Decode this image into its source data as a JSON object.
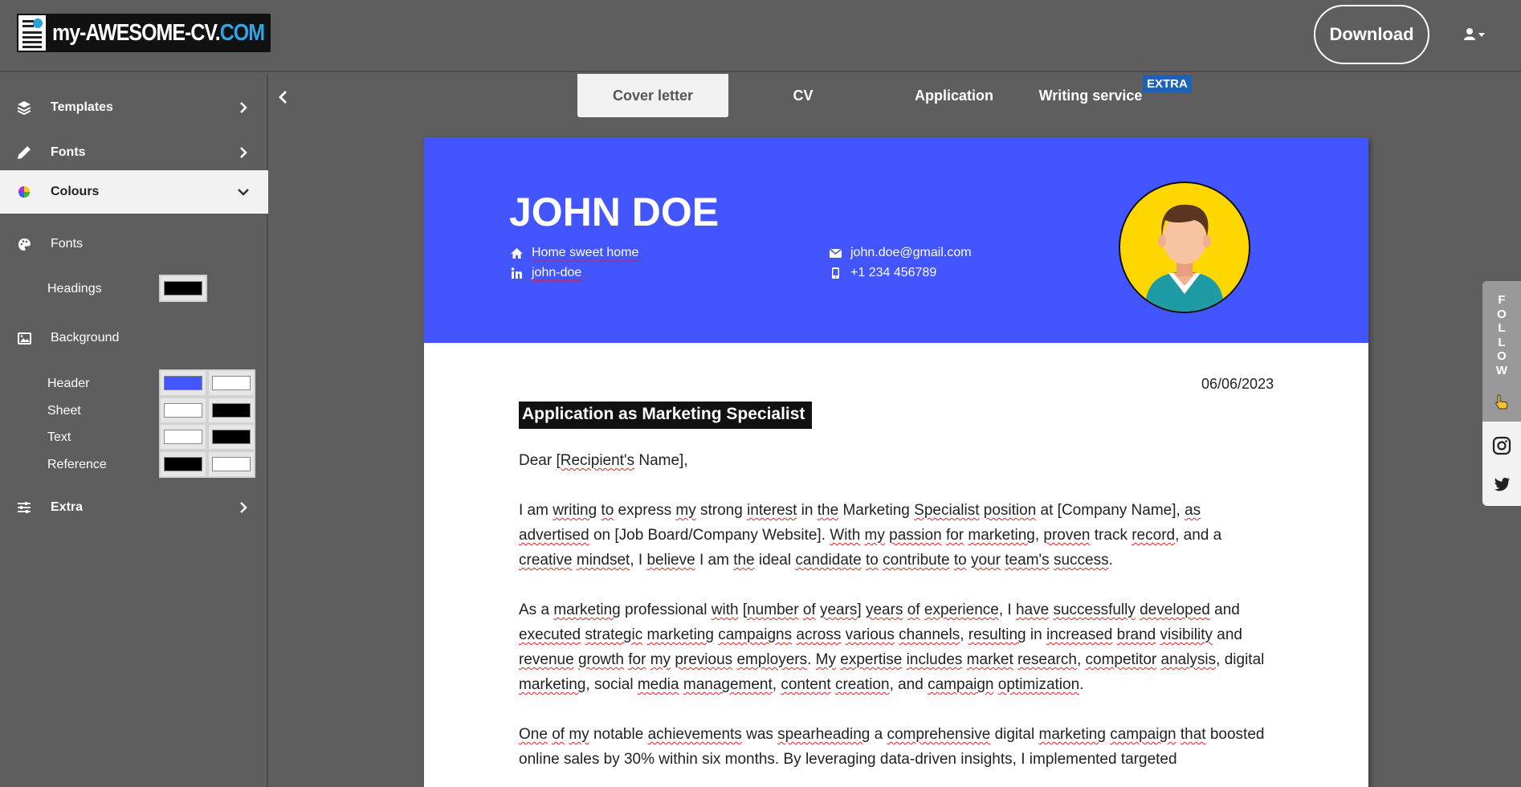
{
  "app": {
    "logo_primary": "my-AWESOME-CV.",
    "logo_accent": "COM",
    "download_label": "Download"
  },
  "sidebar": {
    "templates_label": "Templates",
    "fonts_label": "Fonts",
    "colours_label": "Colours",
    "colours_fonts_label": "Fonts",
    "headings_label": "Headings",
    "background_label": "Background",
    "header_label": "Header",
    "sheet_label": "Sheet",
    "text_label": "Text",
    "reference_label": "Reference",
    "extra_label": "Extra"
  },
  "colors": {
    "headings": "#000000",
    "header_primary": "#4255ff",
    "header_secondary": "#ffffff",
    "sheet_primary": "#ffffff",
    "sheet_secondary": "#000000",
    "text_primary": "#ffffff",
    "text_secondary": "#000000",
    "reference_primary": "#000000",
    "reference_secondary": "#ffffff"
  },
  "tabs": {
    "cover_letter": "Cover letter",
    "cv": "CV",
    "application": "Application",
    "writing_service": "Writing service",
    "extra_badge": "EXTRA"
  },
  "cv": {
    "name": "JOHN DOE",
    "address": "Home sweet home",
    "linkedin": "john-doe",
    "email": "john.doe@gmail.com",
    "phone": "+1 234 456789"
  },
  "letter": {
    "date": "06/06/2023",
    "subject": "Application as Marketing Specialist"
  },
  "social": {
    "follow_label": "FOLLOW"
  }
}
